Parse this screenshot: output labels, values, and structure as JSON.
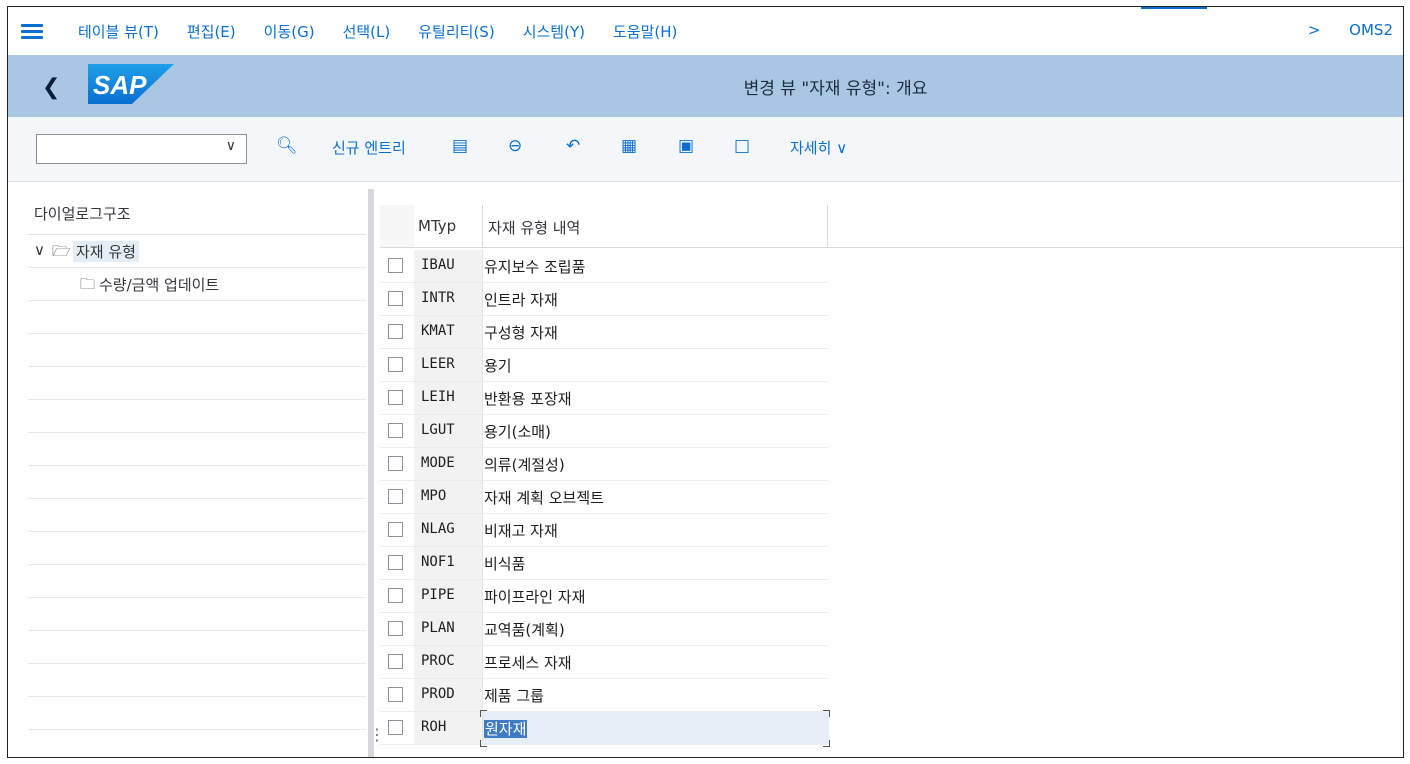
{
  "menubar": {
    "items": [
      "테이블 뷰(T)",
      "편집(E)",
      "이동(G)",
      "선택(L)",
      "유틸리티(S)",
      "시스템(Y)",
      "도움말(H)"
    ],
    "system_id": "OMS2"
  },
  "titlebar": {
    "logo": "SAP",
    "title": "변경 뷰 \"자재 유형\": 개요"
  },
  "toolbar": {
    "combo_value": "",
    "new_entries_label": "신규 엔트리",
    "details_label": "자세히"
  },
  "dialog_structure": {
    "title": "다이얼로그구조",
    "nodes": [
      {
        "label": "자재 유형",
        "selected": true,
        "expanded": true
      },
      {
        "label": "수량/금액 업데이트",
        "selected": false
      }
    ]
  },
  "table": {
    "columns": [
      "MTyp",
      "자재 유형 내역"
    ],
    "rows": [
      {
        "code": "IBAU",
        "desc": "유지보수 조립품"
      },
      {
        "code": "INTR",
        "desc": "인트라 자재"
      },
      {
        "code": "KMAT",
        "desc": "구성형 자재"
      },
      {
        "code": "LEER",
        "desc": "용기"
      },
      {
        "code": "LEIH",
        "desc": "반환용 포장재"
      },
      {
        "code": "LGUT",
        "desc": "용기(소매)"
      },
      {
        "code": "MODE",
        "desc": "의류(계절성)"
      },
      {
        "code": "MPO",
        "desc": "자재 계획 오브젝트"
      },
      {
        "code": "NLAG",
        "desc": "비재고 자재"
      },
      {
        "code": "NOF1",
        "desc": "비식품"
      },
      {
        "code": "PIPE",
        "desc": "파이프라인 자재"
      },
      {
        "code": "PLAN",
        "desc": "교역품(계획)"
      },
      {
        "code": "PROC",
        "desc": "프로세스 자재"
      },
      {
        "code": "PROD",
        "desc": "제품 그룹"
      },
      {
        "code": "ROH",
        "desc": "원자재"
      }
    ]
  },
  "colors": {
    "accent": "#0a6ed1",
    "titlebar": "#a9c7e2",
    "toolbar": "#f4f7fa",
    "sap_logo": "#0a6ed1"
  }
}
